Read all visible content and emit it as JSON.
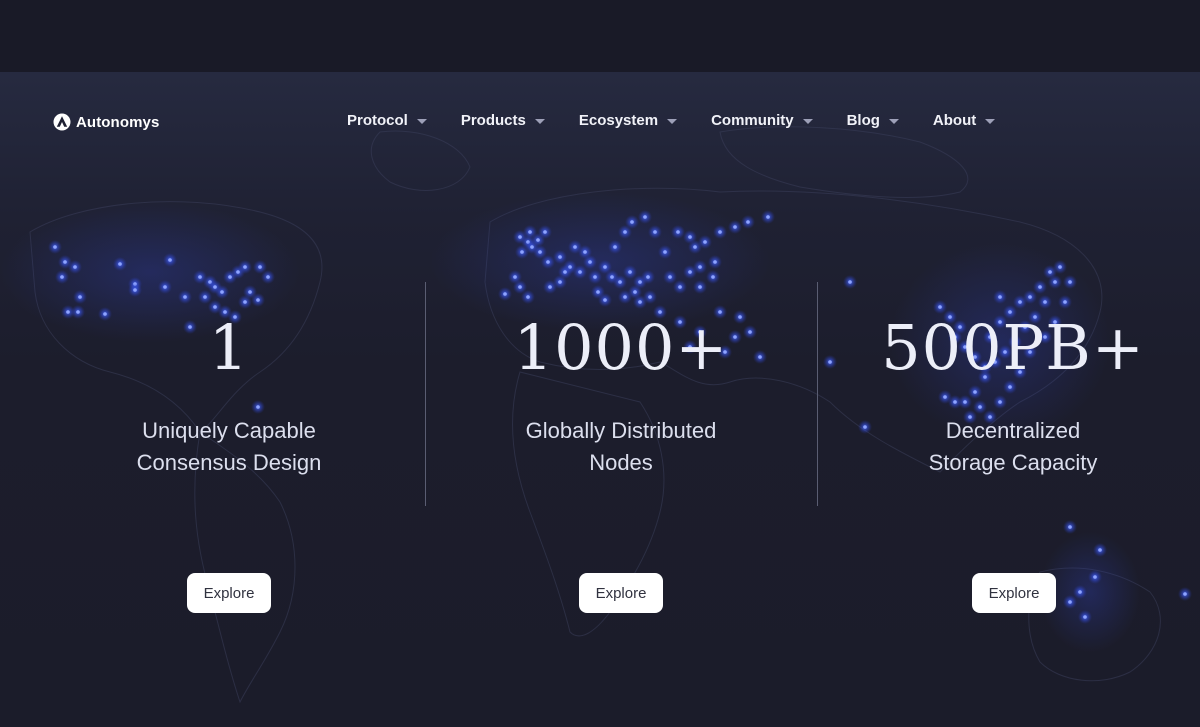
{
  "brand": {
    "name": "Autonomys",
    "logo_icon": "autonomys-logo-icon"
  },
  "nav": {
    "items": [
      {
        "label": "Protocol"
      },
      {
        "label": "Products"
      },
      {
        "label": "Ecosystem"
      },
      {
        "label": "Community"
      },
      {
        "label": "Blog"
      },
      {
        "label": "About"
      }
    ]
  },
  "stats": [
    {
      "value": "1",
      "line1": "Uniquely Capable",
      "line2": "Consensus Design",
      "button": "Explore"
    },
    {
      "value": "1000+",
      "line1": "Globally Distributed",
      "line2": "Nodes",
      "button": "Explore"
    },
    {
      "value": "500PB+",
      "line1": "Decentralized",
      "line2": "Storage Capacity",
      "button": "Explore"
    }
  ],
  "colors": {
    "background": "#1b1c2a",
    "node_glow": "#3d5cff",
    "text": "#eceef8",
    "button_bg": "#ffffff"
  }
}
